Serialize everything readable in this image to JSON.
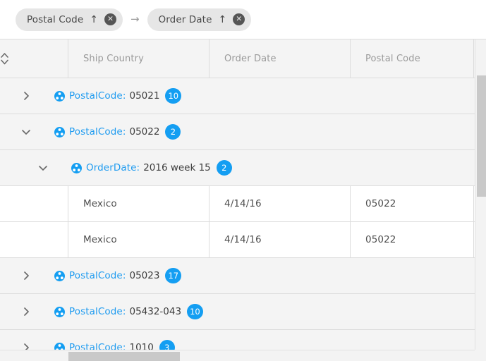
{
  "group_bar": {
    "chips": [
      {
        "label": "Postal Code",
        "sort_icon": "↑",
        "sort_name": "sort-ascending-icon",
        "close_icon": "✕"
      },
      {
        "label": "Order Date",
        "sort_icon": "↑",
        "sort_name": "sort-ascending-icon",
        "close_icon": "✕"
      }
    ],
    "separator": "→"
  },
  "grid": {
    "columns": [
      {
        "key": "expander",
        "label": "",
        "icon": "sort-updown-icon"
      },
      {
        "key": "ship_country",
        "label": "Ship Country"
      },
      {
        "key": "order_date",
        "label": "Order Date"
      },
      {
        "key": "postal_code",
        "label": "Postal Code"
      }
    ],
    "rows": [
      {
        "type": "group",
        "level": 0,
        "expanded": false,
        "chevron": "chevron-right-icon",
        "field": "PostalCode:",
        "value": "05021",
        "count": "10"
      },
      {
        "type": "group",
        "level": 0,
        "expanded": true,
        "chevron": "chevron-down-icon",
        "field": "PostalCode:",
        "value": "05022",
        "count": "2"
      },
      {
        "type": "group",
        "level": 1,
        "expanded": true,
        "chevron": "chevron-down-icon",
        "field": "OrderDate:",
        "value": "2016 week 15",
        "count": "2"
      },
      {
        "type": "data",
        "ship_country": "Mexico",
        "order_date": "4/14/16",
        "postal_code": "05022"
      },
      {
        "type": "data",
        "ship_country": "Mexico",
        "order_date": "4/14/16",
        "postal_code": "05022"
      },
      {
        "type": "group",
        "level": 0,
        "expanded": false,
        "chevron": "chevron-right-icon",
        "field": "PostalCode:",
        "value": "05023",
        "count": "17"
      },
      {
        "type": "group",
        "level": 0,
        "expanded": false,
        "chevron": "chevron-right-icon",
        "field": "PostalCode:",
        "value": "05432-043",
        "count": "10"
      },
      {
        "type": "group",
        "level": 0,
        "expanded": false,
        "chevron": "chevron-right-icon",
        "field": "PostalCode:",
        "value": "1010",
        "count": "3"
      }
    ]
  },
  "colors": {
    "accent": "#149ef2",
    "group_field_text": "#1e9bf0",
    "group_row_bg": "#f4f4f4",
    "data_row_bg": "#ffffff",
    "header_bg": "#f4f4f4",
    "header_text": "#9a9a9a",
    "chip_bg": "#e6e6e6",
    "border": "#dcdcdc",
    "scrollbar_thumb": "#c9c9c9"
  }
}
